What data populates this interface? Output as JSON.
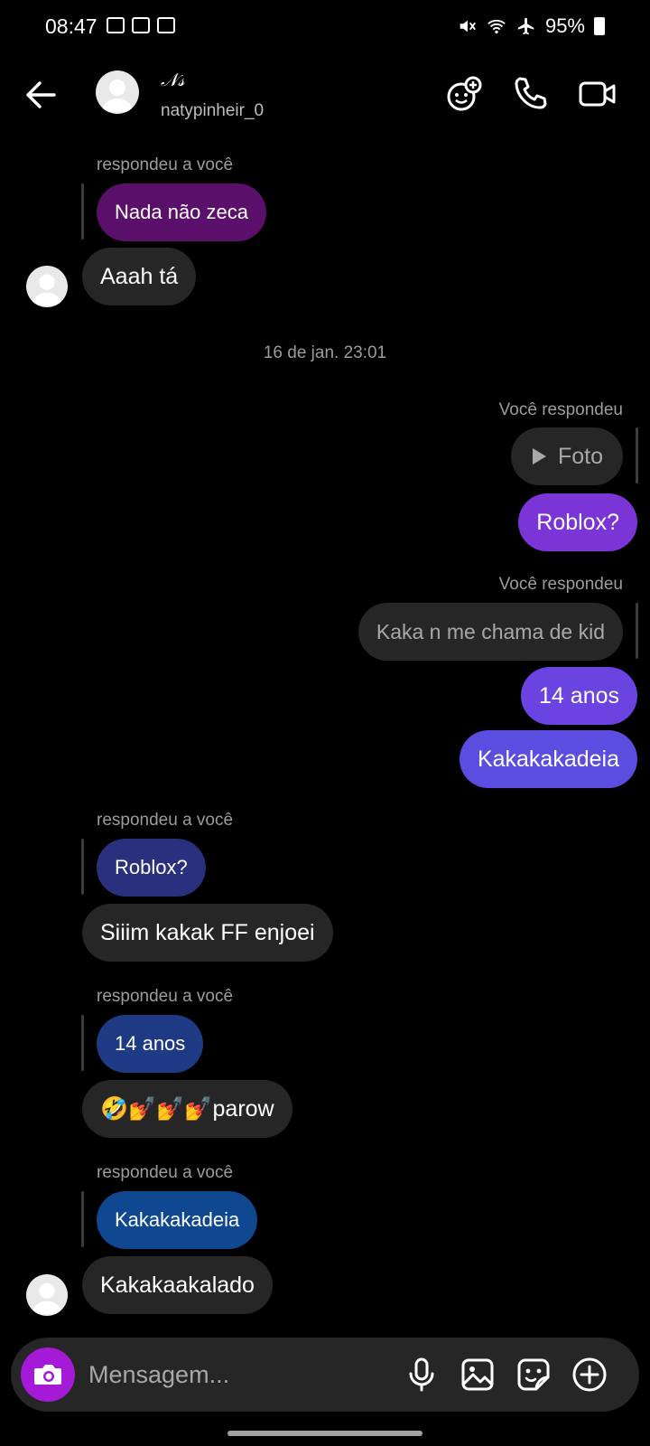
{
  "status_bar": {
    "time": "08:47",
    "battery": "95%"
  },
  "header": {
    "display_name": "𝒩𝓈",
    "username": "natypinheir_0",
    "icons": [
      "back-arrow-icon",
      "effects-icon",
      "phone-icon",
      "video-camera-icon"
    ]
  },
  "messages": {
    "m1_label": "respondeu a você",
    "m1_quote": "Nada não zeca",
    "m1_text": "Aaah tá",
    "timestamp": "16 de jan. 23:01",
    "m2_label": "Você respondeu",
    "m2_quote": "Foto",
    "m2_text": "Roblox?",
    "m3_label": "Você respondeu",
    "m3_quote": "Kaka n me chama de kid",
    "m3_text": "14 anos",
    "m4_text": "Kakakakadeia",
    "m5_label": "respondeu a você",
    "m5_quote": "Roblox?",
    "m5_text": "Siiim kakak FF enjoei",
    "m6_label": "respondeu a você",
    "m6_quote": "14 anos",
    "m6_text": "🤣💅💅💅parow",
    "m7_label": "respondeu a você",
    "m7_quote": "Kakakakadeia",
    "m7_text": "Kakakaakalado"
  },
  "composer": {
    "placeholder": "Mensagem...",
    "icons": [
      "camera-icon",
      "microphone-icon",
      "gallery-icon",
      "sticker-icon",
      "plus-icon"
    ]
  },
  "colors": {
    "background": "#000000",
    "incoming_bubble": "#262626",
    "quote_purple_dark": "#5a0f6b",
    "outgoing_purple": "#7b34d6",
    "outgoing_violet": "#6b43e0",
    "outgoing_indigo": "#5b4ddf",
    "quote_navy": "#2a2f7e",
    "quote_blue": "#1f3a85",
    "quote_steel": "#0f4790",
    "camera_button": "#a41ad7"
  }
}
